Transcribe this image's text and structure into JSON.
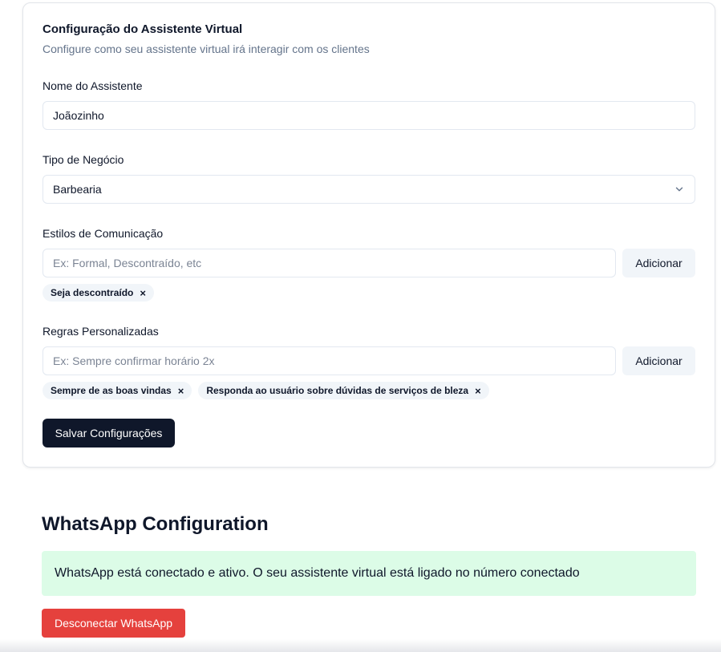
{
  "assistant_config": {
    "title": "Configuração do Assistente Virtual",
    "subtitle": "Configure como seu assistente virtual irá interagir com os clientes",
    "name_label": "Nome do Assistente",
    "name_value": "Joãozinho",
    "business_label": "Tipo de Negócio",
    "business_value": "Barbearia",
    "styles_label": "Estilos de Comunicação",
    "styles_placeholder": "Ex: Formal, Descontraído, etc",
    "styles_add_label": "Adicionar",
    "styles_chips": [
      "Seja descontraído"
    ],
    "rules_label": "Regras Personalizadas",
    "rules_placeholder": "Ex: Sempre confirmar horário 2x",
    "rules_add_label": "Adicionar",
    "rules_chips": [
      "Sempre de as boas vindas",
      "Responda ao usuário sobre dúvidas de serviços de bleza"
    ],
    "chip_remove_symbol": "×",
    "save_label": "Salvar Configurações"
  },
  "whatsapp": {
    "title": "WhatsApp Configuration",
    "status_text": "WhatsApp está conectado e ativo. O seu assistente virtual está ligado no número conectado",
    "disconnect_label": "Desconectar WhatsApp",
    "status_color": "#dcfce7",
    "disconnect_color": "#e5413d"
  },
  "icons": {
    "select_chevron": "chevron-down-icon",
    "chip_remove": "close-icon"
  }
}
